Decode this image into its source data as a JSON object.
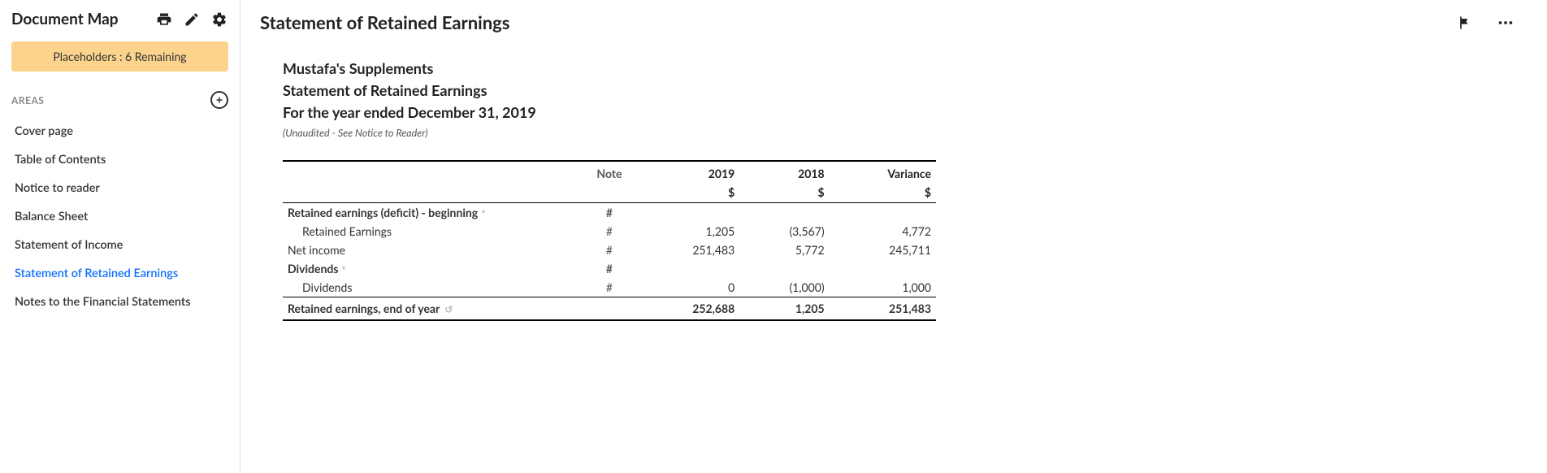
{
  "sidebar": {
    "title": "Document Map",
    "placeholders_label": "Placeholders : 6 Remaining",
    "section_label": "AREAS",
    "items": [
      {
        "label": "Cover page"
      },
      {
        "label": "Table of Contents"
      },
      {
        "label": "Notice to reader"
      },
      {
        "label": "Balance Sheet"
      },
      {
        "label": "Statement of Income"
      },
      {
        "label": "Statement of Retained Earnings"
      },
      {
        "label": "Notes to the Financial Statements"
      }
    ],
    "active_index": 5
  },
  "page": {
    "title": "Statement of Retained Earnings"
  },
  "doc": {
    "company": "Mustafa's Supplements",
    "statement": "Statement of Retained Earnings",
    "period": "For the year ended December 31, 2019",
    "audit_note": "(Unaudited - See Notice to Reader)"
  },
  "table": {
    "headers": {
      "note": "Note",
      "y1": "2019",
      "y2": "2018",
      "var": "Variance"
    },
    "currency": "$",
    "rows": [
      {
        "type": "group",
        "label": "Retained earnings (deficit) - beginning",
        "note": "#",
        "y1": "",
        "y2": "",
        "var": ""
      },
      {
        "type": "indent",
        "label": "Retained Earnings",
        "note": "#",
        "y1": "1,205",
        "y2": "(3,567)",
        "var": "4,772"
      },
      {
        "type": "plain",
        "label": "Net income",
        "note": "#",
        "y1": "251,483",
        "y2": "5,772",
        "var": "245,711"
      },
      {
        "type": "group",
        "label": "Dividends",
        "note": "#",
        "y1": "",
        "y2": "",
        "var": ""
      },
      {
        "type": "indent",
        "label": "Dividends",
        "note": "#",
        "y1": "0",
        "y2": "(1,000)",
        "var": "1,000"
      },
      {
        "type": "total",
        "label": "Retained earnings, end of year",
        "note": "",
        "y1": "252,688",
        "y2": "1,205",
        "var": "251,483"
      }
    ]
  }
}
